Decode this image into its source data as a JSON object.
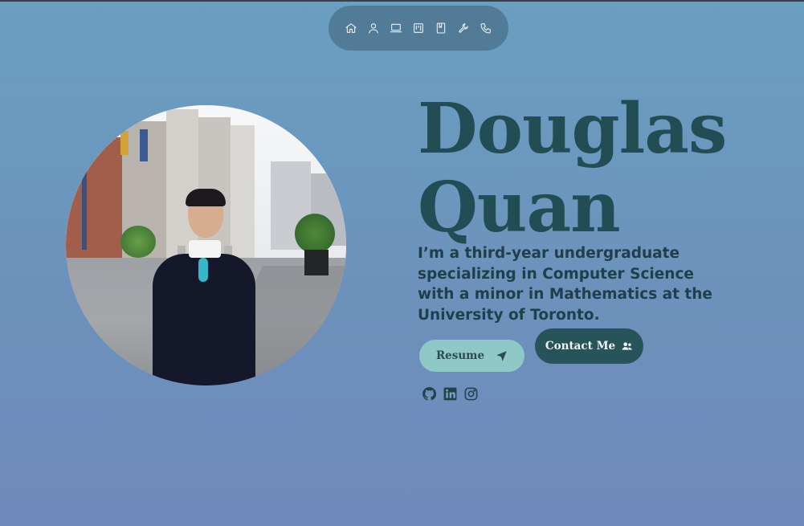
{
  "nav": {
    "items": [
      {
        "icon": "home-icon"
      },
      {
        "icon": "user-icon"
      },
      {
        "icon": "laptop-icon"
      },
      {
        "icon": "kanban-icon"
      },
      {
        "icon": "book-icon"
      },
      {
        "icon": "wrench-icon"
      },
      {
        "icon": "phone-icon"
      }
    ]
  },
  "hero": {
    "name_line1": "Douglas",
    "name_line2": "Quan",
    "bio": "I’m a third-year undergraduate specializing in Computer Science with a minor in Mathematics at the University of Toronto.",
    "resume_label": "Resume",
    "contact_label": "Contact Me"
  },
  "socials": [
    {
      "icon": "github-icon"
    },
    {
      "icon": "linkedin-icon"
    },
    {
      "icon": "instagram-icon"
    }
  ],
  "colors": {
    "name": "#234d55",
    "resume_button": "#8ec9c8",
    "contact_button": "#27535a"
  }
}
